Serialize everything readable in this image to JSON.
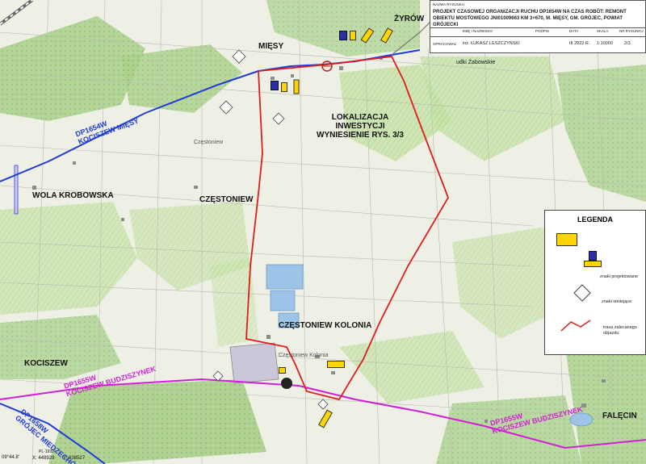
{
  "places": {
    "zyrow": "ŻYRÓW",
    "miesy": "MIĘSY",
    "lokalizacja": [
      "LOKALIZACJA",
      "INWESTYCJI",
      "WYNIESIENIE RYS. 3/3"
    ],
    "wola_krobowska": "WOLA KROBOWSKA",
    "czestoniew": "CZĘSTONIEW",
    "czestoniew_small": "Częstoniew",
    "czestoniew_kolonia": "CZĘSTONIEW KOLONIA",
    "czestoniew_kolonia_small": "Częstoniew Kolonia",
    "kociszew": "KOCISZEW",
    "falecin": "FALĘCIN",
    "budy_zabowskie": "udki Żabowskie"
  },
  "roads": {
    "dp1654w_code": "DP1654W",
    "dp1654w_name": "KOCISZEW MIĘSY",
    "dp1655w_code_left": "DP1655W",
    "dp1655w_name_left": "KOCISZEW BUDZISZYNEK",
    "dp1655w_code_right": "DP1655W",
    "dp1655w_name_right": "KOCISZEW BUDZISZYNEK",
    "dp1658w_code": "DP1658W",
    "dp1658w_name": "GRÓJEC MIEDZECHÓW"
  },
  "titleblock": {
    "header": "NAZWA RYSUNKU",
    "title": "PROJEKT CZASOWEJ ORGANIZACJI RUCHU DP1654W NA CZAS ROBÓT: REMONT OBIEKTU MOSTOWEGO JNI01009663 KM 3+670, M. MIĘSY, GM. GRÓJEC, POWIAT GRÓJECKI",
    "columns": [
      "IMIĘ I NAZWISKO",
      "PODPIS",
      "DATA",
      "SKALA",
      "NR RYSUNKU"
    ],
    "role": "OPRACOWAŁ",
    "name": "inż. ŁUKASZ LESZCZYŃSKI",
    "date": "III 2022 R.",
    "scale": "1:10000",
    "sheet": "2/3"
  },
  "legend": {
    "title": "LEGENDA",
    "projected": "znaki projektowane",
    "existing": "znaki istniejące",
    "detour": "trasa zalecanego objazdu"
  },
  "footer": {
    "coord_prefix": "09°44.8'",
    "x": "X: 448929",
    "y": "Y: 638527",
    "pl": "PL-1992"
  },
  "colors": {
    "detour": "#e01b1b",
    "road_blue": "#1f3bd6",
    "road_magenta": "#d21fd6",
    "forest": "#b9d89a",
    "field": "#eef0e6",
    "water": "#9dc3e6"
  }
}
